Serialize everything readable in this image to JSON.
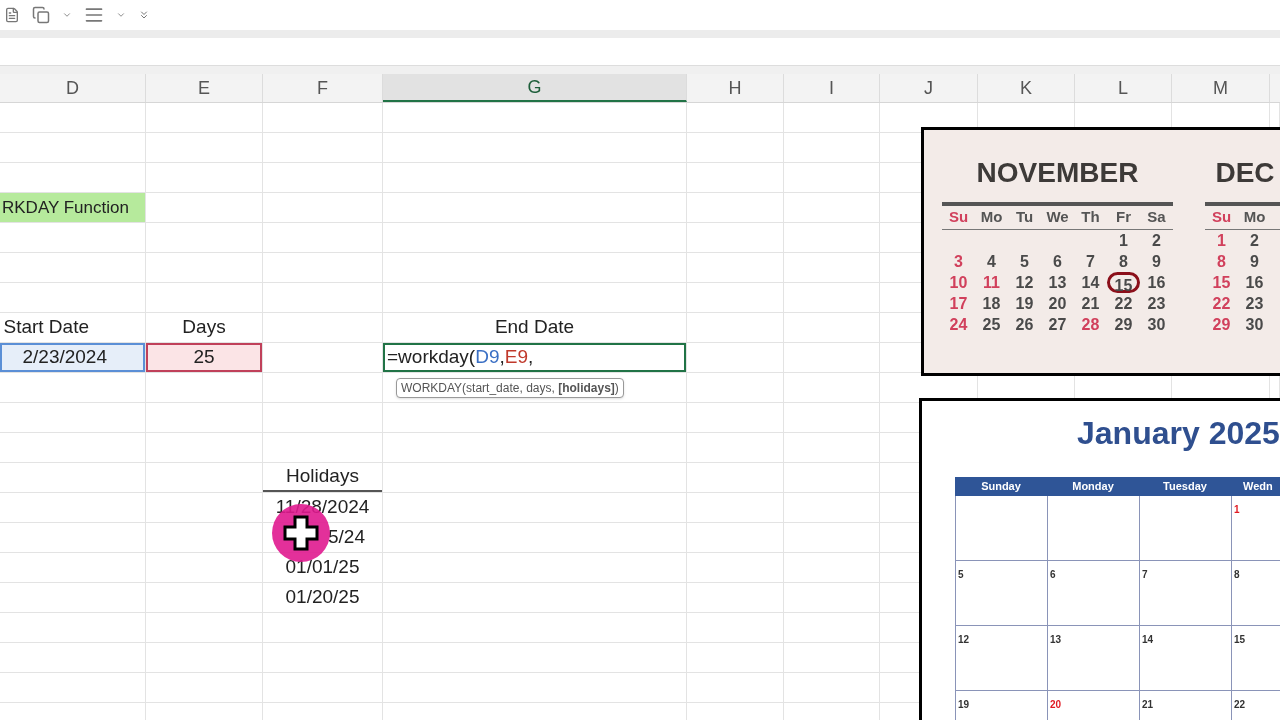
{
  "columns": [
    {
      "label": "D",
      "selected": false
    },
    {
      "label": "E",
      "selected": false
    },
    {
      "label": "F",
      "selected": false
    },
    {
      "label": "G",
      "selected": true
    },
    {
      "label": "H",
      "selected": false
    },
    {
      "label": "I",
      "selected": false
    },
    {
      "label": "J",
      "selected": false
    },
    {
      "label": "K",
      "selected": false
    },
    {
      "label": "L",
      "selected": false
    },
    {
      "label": "M",
      "selected": false
    }
  ],
  "title_label": "RKDAY Function",
  "headers": {
    "start_date": "Start Date",
    "days": "Days",
    "end_date": "End Date"
  },
  "inputs": {
    "start_date": "2/23/2024",
    "days": "25"
  },
  "formula": [
    {
      "text": "=workday(",
      "kind": "plain"
    },
    {
      "text": "D9",
      "kind": "ref_blue"
    },
    {
      "text": ",",
      "kind": "plain"
    },
    {
      "text": "E9",
      "kind": "ref_red"
    },
    {
      "text": ",",
      "kind": "plain"
    }
  ],
  "tooltip": "WORKDAY(start_date, days, **[holidays]**)",
  "holidays": {
    "header": "Holidays",
    "dates": [
      {
        "text": "11/28/2024",
        "covered": false
      },
      {
        "text": "5/24",
        "covered": true
      },
      {
        "text": "01/01/25",
        "covered": false
      },
      {
        "text": "01/20/25",
        "covered": false
      }
    ]
  },
  "november": {
    "title": "NOVEMBER",
    "weekdays": [
      {
        "label": "Su",
        "holiday": true
      },
      {
        "label": "Mo",
        "holiday": false
      },
      {
        "label": "Tu",
        "holiday": false
      },
      {
        "label": "We",
        "holiday": false
      },
      {
        "label": "Th",
        "holiday": false
      },
      {
        "label": "Fr",
        "holiday": false
      },
      {
        "label": "Sa",
        "holiday": false
      }
    ],
    "weeks": [
      [
        {
          "d": "1",
          "holiday": false,
          "circled": false
        },
        {
          "d": "2",
          "holiday": false,
          "circled": false
        }
      ],
      [
        {
          "d": "3",
          "holiday": true,
          "circled": false
        },
        {
          "d": "4",
          "holiday": false,
          "circled": false
        },
        {
          "d": "5",
          "holiday": false,
          "circled": false
        },
        {
          "d": "6",
          "holiday": false,
          "circled": false
        },
        {
          "d": "7",
          "holiday": false,
          "circled": false
        },
        {
          "d": "8",
          "holiday": false,
          "circled": false
        },
        {
          "d": "9",
          "holiday": false,
          "circled": false
        }
      ],
      [
        {
          "d": "10",
          "holiday": true,
          "circled": false
        },
        {
          "d": "11",
          "holiday": true,
          "circled": false
        },
        {
          "d": "12",
          "holiday": false,
          "circled": false
        },
        {
          "d": "13",
          "holiday": false,
          "circled": false
        },
        {
          "d": "14",
          "holiday": false,
          "circled": false
        },
        {
          "d": "15",
          "holiday": false,
          "circled": true
        },
        {
          "d": "16",
          "holiday": false,
          "circled": false
        }
      ],
      [
        {
          "d": "17",
          "holiday": true,
          "circled": false
        },
        {
          "d": "18",
          "holiday": false,
          "circled": false
        },
        {
          "d": "19",
          "holiday": false,
          "circled": false
        },
        {
          "d": "20",
          "holiday": false,
          "circled": false
        },
        {
          "d": "21",
          "holiday": false,
          "circled": false
        },
        {
          "d": "22",
          "holiday": false,
          "circled": false
        },
        {
          "d": "23",
          "holiday": false,
          "circled": false
        }
      ],
      [
        {
          "d": "24",
          "holiday": true,
          "circled": false
        },
        {
          "d": "25",
          "holiday": false,
          "circled": false
        },
        {
          "d": "26",
          "holiday": false,
          "circled": false
        },
        {
          "d": "27",
          "holiday": false,
          "circled": false
        },
        {
          "d": "28",
          "holiday": true,
          "circled": false
        },
        {
          "d": "29",
          "holiday": false,
          "circled": false
        },
        {
          "d": "30",
          "holiday": false,
          "circled": false
        }
      ]
    ]
  },
  "december": {
    "title": "DEC",
    "weekdays": [
      {
        "label": "Su",
        "holiday": true
      },
      {
        "label": "Mo",
        "holiday": false
      }
    ],
    "weeks": [
      [
        {
          "d": "1",
          "holiday": true,
          "circled": false
        },
        {
          "d": "2",
          "holiday": false,
          "circled": false
        }
      ],
      [
        {
          "d": "8",
          "holiday": true,
          "circled": false
        },
        {
          "d": "9",
          "holiday": false,
          "circled": false
        }
      ],
      [
        {
          "d": "15",
          "holiday": true,
          "circled": false
        },
        {
          "d": "16",
          "holiday": false,
          "circled": false
        }
      ],
      [
        {
          "d": "22",
          "holiday": true,
          "circled": false
        },
        {
          "d": "23",
          "holiday": false,
          "circled": false
        }
      ],
      [
        {
          "d": "29",
          "holiday": true,
          "circled": false
        },
        {
          "d": "30",
          "holiday": false,
          "circled": false
        }
      ]
    ]
  },
  "january": {
    "title": "January 2025",
    "weekdays": [
      "Sunday",
      "Monday",
      "Tuesday",
      "Wedn"
    ],
    "weeks": [
      [
        {
          "d": "1",
          "holiday": true
        }
      ],
      [
        {
          "d": "5",
          "holiday": false
        },
        {
          "d": "6",
          "holiday": false
        },
        {
          "d": "7",
          "holiday": false
        },
        {
          "d": "8",
          "holiday": false
        }
      ],
      [
        {
          "d": "12",
          "holiday": false
        },
        {
          "d": "13",
          "holiday": false
        },
        {
          "d": "14",
          "holiday": false
        },
        {
          "d": "15",
          "holiday": false
        }
      ],
      [
        {
          "d": "19",
          "holiday": false
        },
        {
          "d": "20",
          "holiday": true
        },
        {
          "d": "21",
          "holiday": false
        },
        {
          "d": "22",
          "holiday": false
        }
      ]
    ]
  }
}
